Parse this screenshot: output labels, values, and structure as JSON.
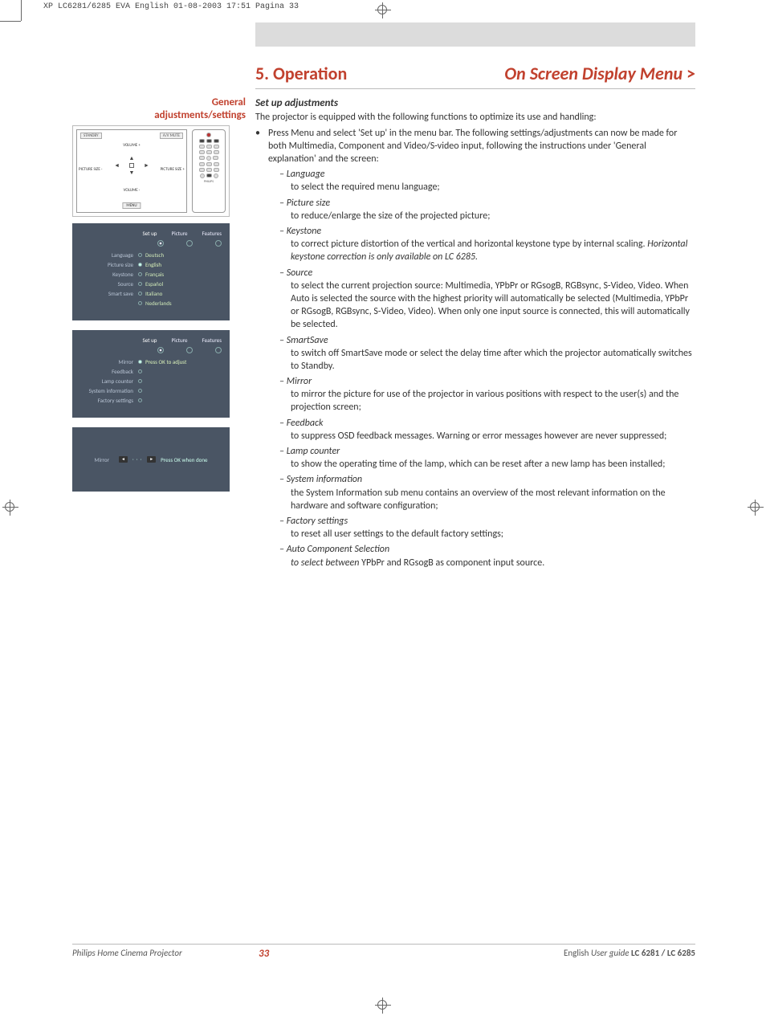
{
  "printer_header": "XP LC6281/6285 EVA English  01-08-2003  17:51  Pagina 33",
  "section": {
    "num": "5. Operation",
    "right": "On Screen Display Menu",
    "gt": ">"
  },
  "sidebar_heading_l1": "General",
  "sidebar_heading_l2": "adjustments/settings",
  "fig1": {
    "standby": "STANDBY",
    "avmute": "A/V MUTE",
    "vol_plus": "VOLUME +",
    "vol_minus": "VOLUME -",
    "ps_minus": "PICTURE SIZE -",
    "ps_plus": "PICTURE SIZE +",
    "menu": "MENU",
    "brand": "PHILIPS"
  },
  "osd1": {
    "tabs": {
      "setup": "Set up",
      "picture": "Picture",
      "features": "Features"
    },
    "rows": [
      {
        "left": "Language",
        "right": "Deutsch"
      },
      {
        "left": "Picture size",
        "right": "English"
      },
      {
        "left": "Keystone",
        "right": "Français"
      },
      {
        "left": "Source",
        "right": "Español"
      },
      {
        "left": "Smart save",
        "right": "Italiano"
      },
      {
        "left": "",
        "right": "Nederlands"
      }
    ]
  },
  "osd2": {
    "tabs": {
      "setup": "Set up",
      "picture": "Picture",
      "features": "Features"
    },
    "rows": [
      {
        "left": "Mirror",
        "right": "Press OK to adjust"
      },
      {
        "left": "Feedback",
        "right": ""
      },
      {
        "left": "Lamp counter",
        "right": ""
      },
      {
        "left": "System information",
        "right": ""
      },
      {
        "left": "Factory settings",
        "right": ""
      }
    ]
  },
  "osd3": {
    "label": "Mirror",
    "k1": "◄",
    "k2": "►",
    "hint": "Press OK when done"
  },
  "heading_setup": "Set up adjustments",
  "intro": "The projector is equipped with the following functions to optimize its use and handling:",
  "bullet_text": "Press Menu and select 'Set up' in the menu bar. The following settings/adjustments can now be made for both Multimedia, Component and Video/S-video input, following the instructions under 'General explanation' and the screen:",
  "settings": {
    "language": {
      "name": "– Language",
      "desc": "to select the required menu language;"
    },
    "picsize": {
      "name": "– Picture size",
      "desc": "to reduce/enlarge the size of the projected picture;"
    },
    "keystone": {
      "name": "– Keystone",
      "desc_a": "to correct picture distortion of the vertical and horizontal keystone type by internal scaling.",
      "desc_b": "Horizontal keystone correction is only available on LC 6285."
    },
    "source": {
      "name": "– Source",
      "desc": "to select the current projection source: Multimedia, YPbPr or RGsogB, RGBsync, S-Video, Video. When Auto is selected the source with the highest priority will automatically be selected (Multimedia, YPbPr or RGsogB, RGBsync, S-Video, Video). When only one input source is connected, this will automatically be selected."
    },
    "smartsave": {
      "name": "– SmartSave",
      "desc": "to switch off SmartSave mode or select the delay time after which the projector automatically switches to Standby."
    },
    "mirror": {
      "name": "– Mirror",
      "desc": "to mirror the picture for use of the projector in various positions with respect to the user(s) and the projection screen;"
    },
    "feedback": {
      "name": "– Feedback",
      "desc": "to suppress OSD feedback messages. Warning or error messages however are never suppressed;"
    },
    "lamp": {
      "name": "– Lamp counter",
      "desc": "to show the operating time of the lamp, which can be reset after a new lamp has been installed;"
    },
    "sysinfo": {
      "name": "– System information",
      "desc": "the System Information sub menu contains an overview of the most relevant information on the hardware and software configuration;"
    },
    "factory": {
      "name": "– Factory settings",
      "desc": "to reset all user settings to the default factory settings;"
    },
    "autocomp": {
      "name": "– Auto Component Selection",
      "desc_a": "to select between",
      "desc_b": " YPbPr and RGsogB as component input source."
    }
  },
  "footer": {
    "left": "Philips Home Cinema Projector",
    "page": "33",
    "right_a": "English ",
    "right_b": "User guide  ",
    "right_c": "LC 6281 / LC 6285"
  }
}
